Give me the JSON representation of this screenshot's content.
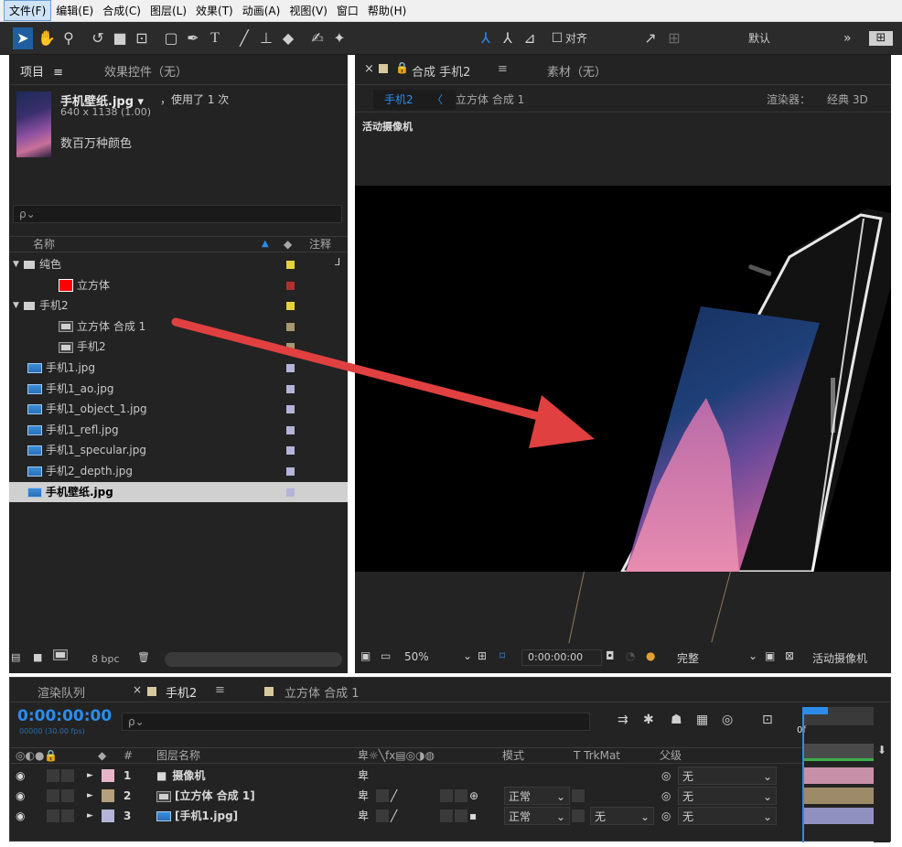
{
  "menubar": [
    "文件(F)",
    "编辑(E)",
    "合成(C)",
    "图层(L)",
    "效果(T)",
    "动画(A)",
    "视图(V)",
    "窗口",
    "帮助(H)"
  ],
  "toolbar": {
    "align_label": "对齐",
    "workspace": "默认",
    "more": "»"
  },
  "project": {
    "tab_label": "项目",
    "tab_menu": "≡",
    "effects_tab": "效果控件（无）",
    "file_name": "手机壁纸.jpg ▾",
    "used_times": "，使用了 1 次",
    "dimensions": "640 x 1138 (1.00)",
    "colors": "数百万种颜色",
    "search_placeholder": "ρ⌄",
    "col_name": "名称",
    "col_comment": "注释",
    "items": [
      {
        "indent": 0,
        "type": "folder",
        "label": "纯色",
        "color": "#e6d23a",
        "arrow": "▼"
      },
      {
        "indent": 1,
        "type": "solid",
        "label": "立方体",
        "color": "#b03030"
      },
      {
        "indent": 0,
        "type": "folder",
        "label": "手机2",
        "color": "#e6d23a",
        "arrow": "▼"
      },
      {
        "indent": 1,
        "type": "comp",
        "label": "立方体 合成 1",
        "color": "#a89870"
      },
      {
        "indent": 1,
        "type": "comp",
        "label": "手机2",
        "color": "#a89870"
      },
      {
        "indent": 0,
        "type": "image",
        "label": "手机1.jpg",
        "color": "#b4b4d8"
      },
      {
        "indent": 0,
        "type": "image",
        "label": "手机1_ao.jpg",
        "color": "#b4b4d8"
      },
      {
        "indent": 0,
        "type": "image",
        "label": "手机1_object_1.jpg",
        "color": "#b4b4d8"
      },
      {
        "indent": 0,
        "type": "image",
        "label": "手机1_refl.jpg",
        "color": "#b4b4d8"
      },
      {
        "indent": 0,
        "type": "image",
        "label": "手机1_specular.jpg",
        "color": "#b4b4d8"
      },
      {
        "indent": 0,
        "type": "image",
        "label": "手机2_depth.jpg",
        "color": "#b4b4d8"
      },
      {
        "indent": 0,
        "type": "image",
        "label": "手机壁纸.jpg",
        "color": "#b4b4d8",
        "selected": true
      }
    ],
    "bpc": "8 bpc"
  },
  "viewer": {
    "tab_comp": "合成 手机2",
    "tab_menu": "≡",
    "tab_footage": "素材（无）",
    "crumb1": "手机2",
    "crumb2": "立方体 合成 1",
    "renderer_label": "渲染器：",
    "renderer_value": "经典 3D",
    "active_camera": "活动摄像机",
    "zoom": "50%",
    "timecode": "0:00:00:00",
    "resolution": "完整",
    "view": "活动摄像机"
  },
  "timeline": {
    "render_queue": "渲染队列",
    "tab1": "手机2",
    "tab1_menu": "≡",
    "tab2": "立方体 合成 1",
    "timecode": "0:00:00:00",
    "frames": "00000 (30.00 fps)",
    "search": "ρ⌄",
    "col_num": "#",
    "col_layer": "图层名称",
    "col_mode": "模式",
    "col_trkmat": "T  TrkMat",
    "col_parent": "父级",
    "ruler_label": "0f",
    "layers": [
      {
        "num": "1",
        "name": "摄像机",
        "color": "#e8b4c8",
        "mode": "",
        "trkmat": "",
        "parent": "无",
        "bar": "#c890a8"
      },
      {
        "num": "2",
        "name": "[立方体 合成 1]",
        "color": "#b4a07c",
        "mode": "正常",
        "trkmat": "",
        "parent": "无",
        "bar": "#9c8a68"
      },
      {
        "num": "3",
        "name": "[手机1.jpg]",
        "color": "#b4b4d8",
        "mode": "正常",
        "trkmat": "无",
        "parent": "无",
        "bar": "#9090c0"
      }
    ]
  },
  "colors": {
    "accent": "#2d8ceb",
    "arrow": "#e04040"
  }
}
